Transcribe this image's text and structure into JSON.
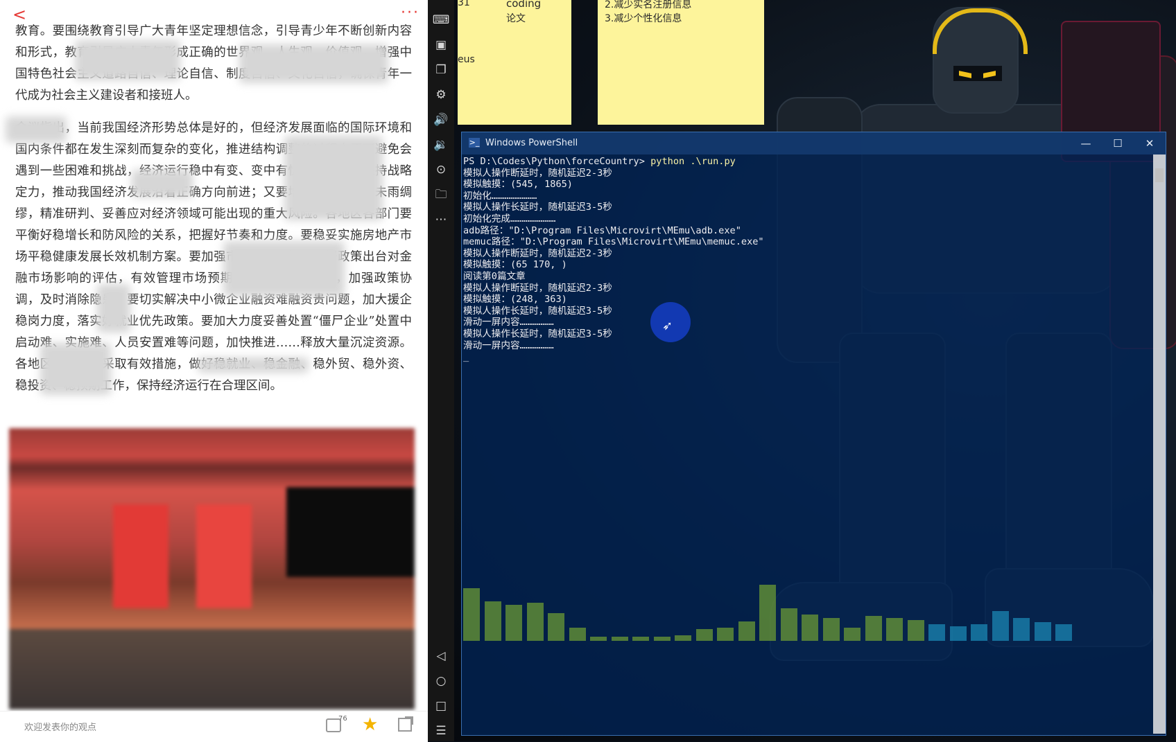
{
  "phone": {
    "article_paragraphs": [
      "教育。要围绕教育引导广大青年坚定理想信念，引导青少年不断创新内容和形式，教育引导广大青年形成正确的世界观、人生观、价值观，增强中国特色社会主义道路自信、理论自信、制度自信、文化自信，确保青年一代成为社会主义建设者和接班人。",
      "会议指出，当前我国经济形势总体是好的，但经济发展面临的国际环境和国内条件都在发生深刻而复杂的变化，推进结构调整的过程中不可避免会遇到一些困难和挑战，经济运行稳中有变、变中有忧，我们既要保持战略定力，推动我国经济发展沿着正确方向前进；又要增强忧患意识，未雨绸缪，精准研判、妥善应对经济领域可能出现的重大风险。各地区各部门要平衡好稳增长和防风险的关系，把握好节奏和力度。要稳妥实施房地产市场平稳健康发展长效机制方案。要加强市场心理分析，做好政策出台对金融市场影响的评估，有效管理市场预期。要加强市场监测，加强政策协调，及时消除隐患。要切实解决中小微企业融资难融资贵问题，加大援企稳岗力度，落实好就业优先政策。要加大力度妥善处置“僵尸企业”处置中启动难、实施难、人员安置难等问题，加快推进……释放大量沉淀资源。各地区各部门要采取有效措施，做好稳就业、稳金融、稳外贸、稳外资、稳投资、稳预期工作，保持经济运行在合理区间。"
    ],
    "comment_placeholder": "欢迎发表你的观点",
    "comment_count": "76",
    "more_label": "···",
    "back_label": "<"
  },
  "sticky_notes": [
    {
      "lines": [
        "31",
        "coding",
        "论文",
        "eus"
      ]
    },
    {
      "lines": [
        "2.减少实名注册信息",
        "3.减少个性化信息"
      ]
    }
  ],
  "sidebar": {
    "icons": [
      "keyboard-icon",
      "apk-icon",
      "multi-window-icon",
      "settings-icon",
      "volume-up-icon",
      "volume-down-icon",
      "location-icon",
      "folder-icon",
      "more-icon",
      "back-nav-icon",
      "home-nav-icon",
      "recent-apps-icon",
      "menu-icon"
    ]
  },
  "powershell": {
    "title": "Windows PowerShell",
    "prompt": "PS D:\\Codes\\Python\\forceCountry> ",
    "command": "python .\\run.py",
    "output_lines": [
      "模拟人操作断延时，随机延迟2-3秒",
      "模拟触摸：(545, 1865)",
      "初始化……………………",
      "模拟人操作长延时，随机延迟3-5秒",
      "初始化完成……………………",
      "adb路径：\"D:\\Program Files\\Microvirt\\MEmu\\adb.exe\"",
      "memuc路径：\"D:\\Program Files\\Microvirt\\MEmu\\memuc.exe\"",
      "模拟人操作断延时，随机延迟2-3秒",
      "模拟触摸：(65 170, )",
      "阅读第0篇文章",
      "模拟人操作断延时，随机延迟2-3秒",
      "模拟触摸：(248, 363)",
      "模拟人操作长延时，随机延迟3-5秒",
      "滑动一屏内容………………",
      "模拟人操作长延时，随机延迟3-5秒",
      "滑动一屏内容………………",
      "_"
    ],
    "minimize": "—",
    "maximize": "☐",
    "close": "✕"
  },
  "equalizer_levels": [
    0.8,
    0.6,
    0.55,
    0.58,
    0.42,
    0.2,
    0.06,
    0.06,
    0.06,
    0.06,
    0.08,
    0.18,
    0.2,
    0.3,
    0.85,
    0.5,
    0.4,
    0.35,
    0.2,
    0.38,
    0.35,
    0.32,
    0.25,
    0.22,
    0.25,
    0.45,
    0.35,
    0.28,
    0.25
  ]
}
